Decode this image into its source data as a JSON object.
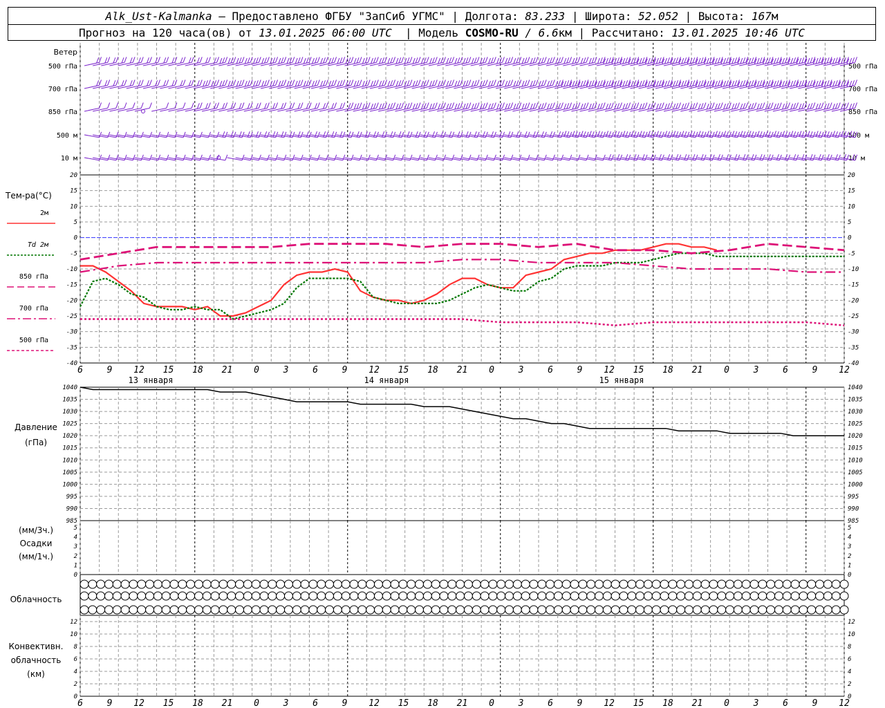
{
  "header": {
    "station": "Alk_Ust-Kalmanka",
    "provider": "– Предоставлено ФГБУ \"ЗапСиб УГМС\" |",
    "lon_label": "Долгота:",
    "lon_value": "83.233",
    "lat_label": "| Широта:",
    "lat_value": "52.052",
    "alt_label": "| Высота:",
    "alt_value": "167",
    "alt_unit": "м",
    "forecast_label": "Прогноз на 120 часа(ов) от",
    "forecast_time": "13.01.2025 06:00 UTC",
    "model_label": "| Модель",
    "model_name": "COSMO-RU",
    "model_res": "/ 6.6",
    "model_res_unit": "км",
    "calc_label": "| Рассчитано:",
    "calc_time": "13.01.2025 10:46 UTC"
  },
  "colors": {
    "t2m": "#ff3333",
    "td2m": "#007700",
    "t850": "#dd1177",
    "t700": "#dd1177",
    "t500": "#dd1177",
    "wind": "#7a22cc",
    "zero_line": "#3333ff",
    "pressure": "#000000",
    "grid": "#999999"
  },
  "wind_panel": {
    "title": "Ветер",
    "levels": [
      "500 гПа",
      "700 гПа",
      "850 гПа",
      "500 м",
      "10 м"
    ],
    "speed_index": [
      [
        2,
        2,
        2,
        2,
        2,
        2,
        2,
        2,
        2,
        2,
        2,
        2,
        2,
        2,
        2,
        3,
        3,
        3,
        3,
        3,
        3,
        3,
        3,
        3,
        3,
        3,
        3,
        3,
        3,
        3,
        3,
        3,
        3,
        3,
        3,
        3,
        3,
        3,
        3,
        3,
        3,
        3,
        3,
        3,
        3,
        3,
        3,
        3,
        3,
        3,
        3,
        3,
        3,
        3,
        3,
        3,
        3,
        3,
        3,
        3,
        3,
        4,
        4,
        4,
        4,
        4,
        4,
        4,
        4,
        4,
        4,
        4,
        4,
        4,
        4,
        4,
        4,
        4,
        4,
        4,
        4,
        4,
        4,
        4,
        4,
        4,
        4,
        4,
        4,
        4,
        4
      ],
      [
        2,
        2,
        2,
        2,
        2,
        2,
        2,
        2,
        2,
        2,
        2,
        2,
        2,
        3,
        3,
        3,
        3,
        3,
        3,
        3,
        3,
        3,
        3,
        3,
        3,
        3,
        3,
        3,
        3,
        3,
        3,
        3,
        3,
        3,
        3,
        3,
        3,
        3,
        3,
        3,
        3,
        3,
        3,
        3,
        3,
        3,
        3,
        3,
        3,
        3,
        3,
        3,
        3,
        3,
        3,
        3,
        4,
        4,
        4,
        4,
        4,
        4,
        4,
        4,
        4,
        4,
        4,
        4,
        4,
        4,
        4,
        4,
        4,
        4,
        4,
        4,
        4,
        4,
        4,
        4,
        4,
        4,
        4,
        4,
        4,
        4,
        4,
        4,
        4,
        4,
        4
      ],
      [
        1,
        1,
        1,
        1,
        1,
        1,
        1,
        0,
        1,
        1,
        1,
        1,
        2,
        2,
        2,
        2,
        2,
        2,
        2,
        2,
        2,
        2,
        2,
        2,
        2,
        2,
        2,
        2,
        2,
        2,
        2,
        3,
        3,
        3,
        3,
        3,
        3,
        3,
        3,
        3,
        3,
        3,
        3,
        3,
        3,
        3,
        3,
        3,
        3,
        3,
        3,
        3,
        3,
        3,
        3,
        3,
        3,
        3,
        3,
        3,
        3,
        3,
        3,
        3,
        3,
        3,
        3,
        3,
        3,
        3,
        3,
        3,
        3,
        3,
        3,
        3,
        3,
        3,
        3,
        3,
        3,
        3,
        3,
        3,
        3,
        3,
        3,
        3,
        3,
        3,
        3
      ],
      [
        1,
        1,
        1,
        1,
        1,
        1,
        1,
        1,
        1,
        1,
        1,
        1,
        1,
        1,
        1,
        2,
        2,
        2,
        2,
        2,
        2,
        2,
        2,
        2,
        2,
        2,
        2,
        2,
        2,
        2,
        2,
        2,
        2,
        2,
        2,
        2,
        2,
        2,
        2,
        2,
        2,
        2,
        2,
        2,
        2,
        2,
        2,
        2,
        2,
        2,
        2,
        2,
        2,
        2,
        2,
        2,
        3,
        3,
        3,
        3,
        3,
        3,
        3,
        3,
        3,
        3,
        3,
        3,
        3,
        3,
        3,
        3,
        3,
        3,
        3,
        3,
        3,
        3,
        3,
        3,
        3,
        3,
        3,
        3,
        3,
        3,
        3,
        3,
        3,
        3,
        3
      ],
      [
        1,
        1,
        1,
        1,
        1,
        1,
        1,
        1,
        1,
        1,
        1,
        1,
        1,
        1,
        1,
        1,
        0,
        1,
        1,
        1,
        1,
        1,
        1,
        1,
        1,
        1,
        1,
        1,
        1,
        1,
        1,
        1,
        1,
        1,
        1,
        1,
        1,
        1,
        1,
        1,
        1,
        1,
        1,
        1,
        1,
        1,
        1,
        1,
        1,
        1,
        1,
        1,
        1,
        1,
        1,
        1,
        1,
        1,
        1,
        1,
        1,
        2,
        2,
        2,
        2,
        2,
        2,
        2,
        2,
        2,
        2,
        2,
        2,
        2,
        2,
        2,
        2,
        2,
        2,
        2,
        2,
        2,
        2,
        2,
        2,
        2,
        2,
        2,
        2,
        2,
        2
      ]
    ]
  },
  "temp_panel": {
    "title": "Тем-ра(°С)",
    "legend": [
      "2м",
      "Td 2м",
      "850 гПа",
      "700 гПа",
      "500 гПа"
    ]
  },
  "pressure_panel": {
    "title_line1": "Давление",
    "title_line2": "(гПа)"
  },
  "precip_panel": {
    "line1": "(мм/3ч.)",
    "line2": "Осадки",
    "line3": "(мм/1ч.)"
  },
  "cloud_panel": {
    "title": "Облачность",
    "rows": [
      [
        0,
        0,
        0,
        0,
        0,
        0,
        0,
        0,
        0,
        0,
        0,
        0,
        0,
        0,
        0,
        0,
        0,
        0,
        0,
        0,
        0,
        0,
        0,
        0,
        0,
        0,
        0,
        0,
        0,
        0,
        0,
        0,
        0,
        0,
        0,
        0,
        0,
        0,
        0,
        0,
        0,
        0,
        0,
        0,
        0,
        0,
        0,
        0,
        0,
        0,
        0,
        0,
        0,
        0,
        0,
        0,
        0,
        0,
        0,
        0,
        0,
        0,
        0,
        0,
        0,
        0,
        0,
        0,
        0,
        0,
        0,
        0,
        0,
        0,
        0,
        0,
        0,
        0,
        0,
        0,
        0,
        0,
        0,
        0,
        0,
        0,
        0,
        0,
        0,
        0,
        0,
        0,
        0,
        0
      ],
      [
        0,
        0,
        0,
        0,
        0,
        0,
        0,
        0,
        0,
        0,
        0,
        0,
        0,
        0,
        0,
        0,
        0,
        0,
        0,
        0,
        0,
        0,
        0,
        0,
        0,
        0,
        0,
        0,
        0,
        0,
        0,
        0,
        0,
        0,
        0,
        0,
        0,
        0,
        0,
        0,
        0,
        0,
        0,
        0,
        0,
        0,
        0,
        0,
        0,
        0,
        0,
        0,
        0,
        0,
        0,
        0,
        0,
        0,
        0,
        0,
        0,
        0,
        0,
        0,
        0,
        0,
        0,
        0,
        0,
        0,
        0,
        0,
        0,
        0,
        0,
        0,
        0,
        0,
        0,
        0,
        0,
        0,
        0,
        0,
        0,
        0,
        0,
        0,
        0,
        0,
        0,
        0,
        0,
        0
      ],
      [
        0,
        0,
        0,
        0,
        0,
        0,
        0,
        0,
        0,
        0,
        0,
        0,
        0,
        0,
        0,
        0,
        0,
        0,
        0,
        0,
        0,
        0,
        0,
        0,
        0,
        0,
        0,
        0,
        0,
        0,
        0,
        0,
        0,
        0,
        0,
        0,
        0,
        0,
        0,
        0,
        0,
        0,
        0,
        0,
        0,
        0,
        0,
        0,
        0,
        0,
        0,
        0,
        0,
        0,
        0,
        0,
        0,
        0,
        0,
        0,
        0,
        0,
        0,
        0,
        0,
        0,
        0,
        0,
        0,
        0,
        0,
        0,
        0,
        0,
        0,
        0,
        0,
        0,
        0,
        0,
        0,
        0,
        0,
        0,
        0,
        0,
        0,
        0,
        0,
        0,
        0,
        0,
        0,
        0
      ]
    ]
  },
  "conv_panel": {
    "line1": "Конвективн.",
    "line2": "облачность",
    "line3": "(км)"
  },
  "chart_data": {
    "type": "line",
    "x_ticks": [
      "6",
      "9",
      "12",
      "15",
      "18",
      "21",
      "0",
      "3",
      "6",
      "9",
      "12",
      "15",
      "18",
      "21",
      "0",
      "3",
      "6",
      "9",
      "12",
      "15",
      "18",
      "21",
      "0",
      "3",
      "6",
      "9",
      "12"
    ],
    "dates": [
      "13 января",
      "14 января",
      "15 января"
    ],
    "hours_start": 6,
    "hours_end": 126,
    "temperature": {
      "ylim": [
        -40,
        20
      ],
      "yticks": [
        20,
        15,
        10,
        5,
        0,
        -5,
        -10,
        -15,
        -20,
        -25,
        -30,
        -35,
        -40
      ],
      "series": [
        {
          "name": "2м",
          "x": [
            0,
            2,
            4,
            6,
            8,
            10,
            12,
            14,
            16,
            18,
            20,
            22,
            24,
            26,
            27,
            28,
            30,
            32,
            34,
            36,
            38,
            40,
            42,
            44,
            46,
            48,
            50,
            52,
            54,
            56,
            58,
            60,
            62,
            64,
            66,
            68,
            70,
            72,
            74,
            76,
            78,
            80,
            82,
            84,
            86,
            88,
            90,
            92,
            94,
            96,
            98,
            100,
            102,
            104,
            106,
            108,
            110,
            112,
            114,
            116,
            118,
            120
          ],
          "y": [
            -9,
            -9,
            -11,
            -14,
            -17,
            -21,
            -22,
            -22,
            -22,
            -23,
            -22,
            -25,
            -25,
            -24,
            -23,
            -22,
            -20,
            -15,
            -12,
            -11,
            -11,
            -10,
            -11,
            -17,
            -19,
            -20,
            -20,
            -21,
            -20,
            -18,
            -15,
            -13,
            -13,
            -15,
            -16,
            -16,
            -12,
            -11,
            -10,
            -7,
            -6,
            -5,
            -5,
            -4,
            -4,
            -4,
            -3,
            -2,
            -2,
            -3,
            -3,
            -4
          ]
        },
        {
          "name": "Td 2м",
          "x": [
            0,
            2,
            4,
            6,
            8,
            10,
            12,
            14,
            16,
            18,
            20,
            22,
            24,
            26,
            28,
            30,
            32,
            34,
            36,
            38,
            40,
            42,
            44,
            46,
            48,
            50,
            52,
            54,
            56,
            58,
            60,
            62,
            64,
            66,
            68,
            70,
            72,
            74,
            76,
            78,
            80,
            82,
            84,
            86,
            88,
            90,
            92,
            94,
            96,
            98,
            100,
            102,
            104,
            106,
            108,
            110,
            112,
            114,
            116,
            118,
            120
          ],
          "y": [
            -22,
            -14,
            -13,
            -15,
            -18,
            -19,
            -22,
            -23,
            -23,
            -22,
            -23,
            -23,
            -26,
            -25,
            -24,
            -23,
            -21,
            -16,
            -13,
            -13,
            -13,
            -13,
            -14,
            -19,
            -20,
            -21,
            -21,
            -21,
            -21,
            -20,
            -18,
            -16,
            -15,
            -16,
            -17,
            -17,
            -14,
            -13,
            -10,
            -9,
            -9,
            -9,
            -8,
            -8,
            -8,
            -7,
            -6,
            -5,
            -5,
            -5,
            -6,
            -6,
            -6,
            -6,
            -6,
            -6,
            -6,
            -6,
            -6,
            -6,
            -6
          ]
        },
        {
          "name": "850 гПа",
          "x": [
            0,
            6,
            12,
            18,
            24,
            30,
            36,
            42,
            48,
            54,
            60,
            66,
            72,
            78,
            84,
            90,
            96,
            102,
            108,
            114,
            120
          ],
          "y": [
            -7,
            -5,
            -3,
            -3,
            -3,
            -3,
            -2,
            -2,
            -2,
            -3,
            -2,
            -2,
            -3,
            -2,
            -4,
            -4,
            -5,
            -4,
            -2,
            -3,
            -4
          ]
        },
        {
          "name": "700 гПа",
          "x": [
            0,
            6,
            12,
            18,
            24,
            30,
            36,
            42,
            48,
            54,
            60,
            66,
            72,
            78,
            84,
            90,
            96,
            102,
            108,
            114,
            120
          ],
          "y": [
            -11,
            -9,
            -8,
            -8,
            -8,
            -8,
            -8,
            -8,
            -8,
            -8,
            -7,
            -7,
            -8,
            -8,
            -8,
            -9,
            -10,
            -10,
            -10,
            -11,
            -11
          ]
        },
        {
          "name": "500 гПа",
          "x": [
            0,
            6,
            12,
            18,
            24,
            30,
            36,
            42,
            48,
            54,
            60,
            66,
            72,
            78,
            84,
            90,
            96,
            102,
            108,
            114,
            120
          ],
          "y": [
            -26,
            -26,
            -26,
            -26,
            -26,
            -26,
            -26,
            -26,
            -26,
            -26,
            -26,
            -27,
            -27,
            -27,
            -28,
            -27,
            -27,
            -27,
            -27,
            -27,
            -28
          ]
        }
      ]
    },
    "pressure": {
      "ylim": [
        985,
        1040
      ],
      "yticks": [
        1040,
        1035,
        1030,
        1025,
        1020,
        1015,
        1010,
        1005,
        1000,
        995,
        990,
        985
      ],
      "x": [
        0,
        2,
        4,
        6,
        8,
        10,
        12,
        14,
        16,
        18,
        20,
        22,
        24,
        26,
        28,
        30,
        32,
        34,
        36,
        38,
        40,
        42,
        44,
        46,
        48,
        50,
        52,
        54,
        56,
        58,
        60,
        62,
        64,
        66,
        68,
        70,
        72,
        74,
        76,
        78,
        80,
        82,
        84,
        86,
        88,
        90,
        92,
        94,
        96,
        98,
        100,
        102,
        104,
        106,
        108,
        110,
        112,
        114,
        116,
        118,
        120
      ],
      "y": [
        1040,
        1039,
        1039,
        1039,
        1039,
        1039,
        1039,
        1039,
        1039,
        1039,
        1039,
        1038,
        1038,
        1038,
        1037,
        1036,
        1035,
        1034,
        1034,
        1034,
        1034,
        1034,
        1033,
        1033,
        1033,
        1033,
        1033,
        1032,
        1032,
        1032,
        1031,
        1030,
        1029,
        1028,
        1027,
        1027,
        1026,
        1025,
        1025,
        1024,
        1023,
        1023,
        1023,
        1023,
        1023,
        1023,
        1023,
        1022,
        1022,
        1022,
        1022,
        1021,
        1021,
        1021,
        1021,
        1021,
        1020,
        1020,
        1020,
        1020,
        1020
      ]
    },
    "precip": {
      "ylim": [
        0,
        5
      ],
      "yticks": [
        5,
        4,
        3,
        2,
        1,
        0
      ],
      "values": []
    },
    "convective_cloud": {
      "ylim": [
        0,
        13
      ],
      "yticks": [
        12,
        10,
        8,
        6,
        4,
        2,
        0
      ],
      "values": []
    }
  }
}
